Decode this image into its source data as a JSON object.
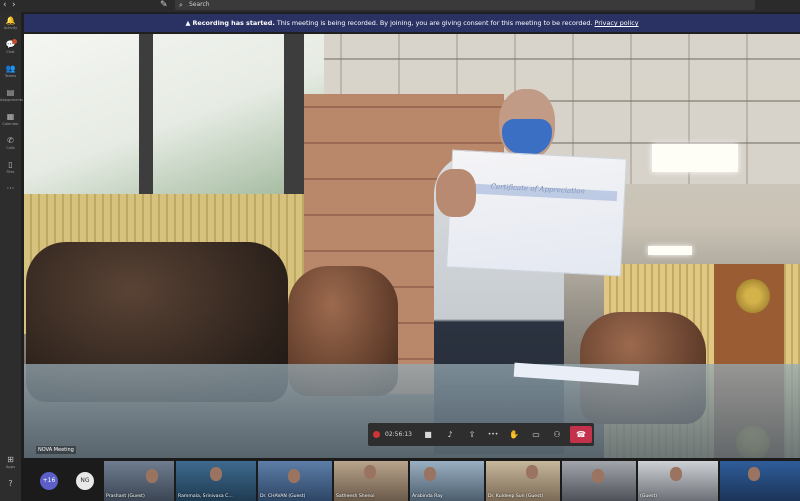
{
  "topbar": {
    "back_glyph": "‹",
    "forward_glyph": "›",
    "compose_glyph": "✎",
    "search_icon": "⌕",
    "search_text": "Search"
  },
  "rail": {
    "items": [
      {
        "icon": "bell-icon",
        "glyph": "🔔",
        "label": "Activity"
      },
      {
        "icon": "chat-icon",
        "glyph": "💬",
        "label": "Chat"
      },
      {
        "icon": "teams-icon",
        "glyph": "👥",
        "label": "Teams"
      },
      {
        "icon": "assignments-icon",
        "glyph": "▤",
        "label": "Assignments"
      },
      {
        "icon": "calendar-icon",
        "glyph": "▦",
        "label": "Calendar"
      },
      {
        "icon": "calls-icon",
        "glyph": "✆",
        "label": "Calls"
      },
      {
        "icon": "files-icon",
        "glyph": "▯",
        "label": "Files"
      },
      {
        "icon": "more-icon",
        "glyph": "···",
        "label": ""
      }
    ],
    "apps": {
      "icon": "apps-icon",
      "glyph": "⊞",
      "label": "Apps"
    },
    "help": {
      "icon": "help-icon",
      "glyph": "?",
      "label": ""
    }
  },
  "banner": {
    "warning_glyph": "▲",
    "title": "Recording has started.",
    "message": "This meeting is being recorded. By joining, you are giving consent for this meeting to be recorded.",
    "link": "Privacy policy"
  },
  "certificate": {
    "title": "Certificate of Appreciation"
  },
  "controls": {
    "timer": "02:56:13",
    "camera_glyph": "■",
    "mic_glyph": "♪",
    "share_glyph": "⇧",
    "more_glyph": "•••",
    "raise_hand_glyph": "✋",
    "chat_glyph": "▭",
    "participants_glyph": "⚇",
    "hangup_glyph": "☎"
  },
  "meeting_name": "NOVA Meeting",
  "strip": {
    "overflow_count": "+16",
    "initials": "NG",
    "tiles": [
      {
        "name": "Prashant (Guest)"
      },
      {
        "name": "Rammala, Srinivasa C..."
      },
      {
        "name": "Dr. CHAVAN (Guest)"
      },
      {
        "name": "Satheesh Shenoi"
      },
      {
        "name": "Arabinda Ray"
      },
      {
        "name": "Dr. Kuldeep Sun (Guest)"
      },
      {
        "name": ""
      },
      {
        "name": "(Guest)"
      },
      {
        "name": ""
      }
    ]
  },
  "colors": {
    "banner_bg": "#2a3264",
    "hangup": "#c4314b",
    "record": "#d13438",
    "overflow_bubble": "#5b5fc7",
    "initials_bubble": "#e8e8e8"
  }
}
